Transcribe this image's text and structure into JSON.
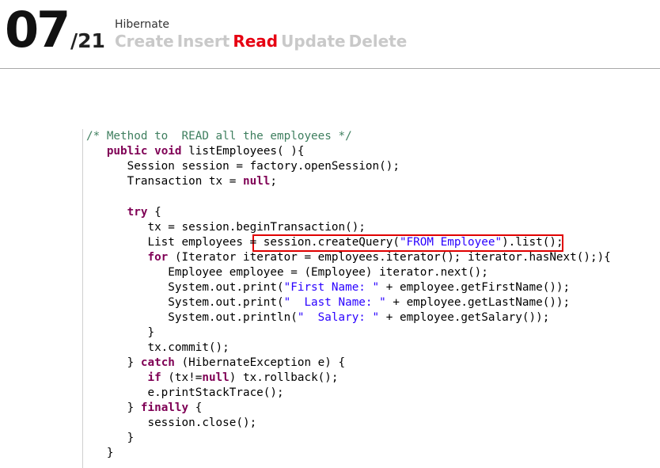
{
  "header": {
    "slide_number": "07",
    "slide_total": "/21",
    "section_title": "Hibernate",
    "crud": [
      {
        "label": "Create",
        "active": false
      },
      {
        "label": "Insert",
        "active": false
      },
      {
        "label": "Read",
        "active": true
      },
      {
        "label": "Update",
        "active": false
      },
      {
        "label": "Delete",
        "active": false
      }
    ]
  },
  "colors": {
    "accent": "#e60012",
    "inactive_text": "#c9c9c9",
    "comment": "#3f7f5f",
    "keyword": "#7f0055",
    "string": "#2a00ff",
    "highlight_box": "#e00000"
  },
  "code": {
    "highlighted_text": "session.createQuery(\"FROM Employee\").list();",
    "lines": [
      {
        "tokens": [
          {
            "t": "comment",
            "v": "/* Method to  READ all the employees */"
          }
        ]
      },
      {
        "tokens": [
          {
            "t": "plain",
            "v": "   "
          },
          {
            "t": "keyword",
            "v": "public"
          },
          {
            "t": "plain",
            "v": " "
          },
          {
            "t": "keyword",
            "v": "void"
          },
          {
            "t": "plain",
            "v": " listEmployees( ){"
          }
        ]
      },
      {
        "tokens": [
          {
            "t": "plain",
            "v": "      Session session = factory.openSession();"
          }
        ]
      },
      {
        "tokens": [
          {
            "t": "plain",
            "v": "      Transaction tx = "
          },
          {
            "t": "keyword",
            "v": "null"
          },
          {
            "t": "plain",
            "v": ";"
          }
        ]
      },
      {
        "tokens": [
          {
            "t": "plain",
            "v": ""
          }
        ]
      },
      {
        "tokens": [
          {
            "t": "plain",
            "v": "      "
          },
          {
            "t": "keyword",
            "v": "try"
          },
          {
            "t": "plain",
            "v": " {"
          }
        ]
      },
      {
        "tokens": [
          {
            "t": "plain",
            "v": "         tx = session.beginTransaction();"
          }
        ]
      },
      {
        "tokens": [
          {
            "t": "plain",
            "v": "         List employees = session.createQuery("
          },
          {
            "t": "string",
            "v": "\"FROM Employee\""
          },
          {
            "t": "plain",
            "v": ").list();"
          }
        ]
      },
      {
        "tokens": [
          {
            "t": "plain",
            "v": "         "
          },
          {
            "t": "keyword",
            "v": "for"
          },
          {
            "t": "plain",
            "v": " (Iterator iterator = employees.iterator(); iterator.hasNext();){"
          }
        ]
      },
      {
        "tokens": [
          {
            "t": "plain",
            "v": "            Employee employee = (Employee) iterator.next();"
          }
        ]
      },
      {
        "tokens": [
          {
            "t": "plain",
            "v": "            System.out.print("
          },
          {
            "t": "string",
            "v": "\"First Name: \""
          },
          {
            "t": "plain",
            "v": " + employee.getFirstName());"
          }
        ]
      },
      {
        "tokens": [
          {
            "t": "plain",
            "v": "            System.out.print("
          },
          {
            "t": "string",
            "v": "\"  Last Name: \""
          },
          {
            "t": "plain",
            "v": " + employee.getLastName());"
          }
        ]
      },
      {
        "tokens": [
          {
            "t": "plain",
            "v": "            System.out.println("
          },
          {
            "t": "string",
            "v": "\"  Salary: \""
          },
          {
            "t": "plain",
            "v": " + employee.getSalary());"
          }
        ]
      },
      {
        "tokens": [
          {
            "t": "plain",
            "v": "         }"
          }
        ]
      },
      {
        "tokens": [
          {
            "t": "plain",
            "v": "         tx.commit();"
          }
        ]
      },
      {
        "tokens": [
          {
            "t": "plain",
            "v": "      } "
          },
          {
            "t": "keyword",
            "v": "catch"
          },
          {
            "t": "plain",
            "v": " (HibernateException e) {"
          }
        ]
      },
      {
        "tokens": [
          {
            "t": "plain",
            "v": "         "
          },
          {
            "t": "keyword",
            "v": "if"
          },
          {
            "t": "plain",
            "v": " (tx!="
          },
          {
            "t": "keyword",
            "v": "null"
          },
          {
            "t": "plain",
            "v": ") tx.rollback();"
          }
        ]
      },
      {
        "tokens": [
          {
            "t": "plain",
            "v": "         e.printStackTrace();"
          }
        ]
      },
      {
        "tokens": [
          {
            "t": "plain",
            "v": "      } "
          },
          {
            "t": "keyword",
            "v": "finally"
          },
          {
            "t": "plain",
            "v": " {"
          }
        ]
      },
      {
        "tokens": [
          {
            "t": "plain",
            "v": "         session.close();"
          }
        ]
      },
      {
        "tokens": [
          {
            "t": "plain",
            "v": "      }"
          }
        ]
      },
      {
        "tokens": [
          {
            "t": "plain",
            "v": "   }"
          }
        ]
      }
    ]
  }
}
